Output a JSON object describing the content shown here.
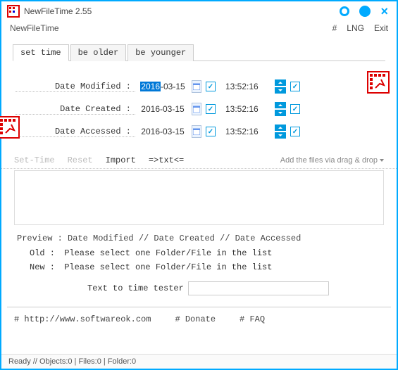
{
  "window": {
    "title": "NewFileTime 2.55",
    "app_name": "NewFileTime"
  },
  "menu": {
    "hash": "#",
    "lng": "LNG",
    "exit": "Exit"
  },
  "tabs": {
    "set_time": "set time",
    "be_older": "be older",
    "be_younger": "be younger"
  },
  "rows": {
    "modified": {
      "label": "Date Modified :",
      "date_prefix": "2016",
      "date_suffix": "-03-15",
      "time": "13:52:16"
    },
    "created": {
      "label": "Date Created :",
      "date": "2016-03-15",
      "time": "13:52:16"
    },
    "accessed": {
      "label": "Date Accessed :",
      "date": "2016-03-15",
      "time": "13:52:16"
    }
  },
  "toolbar": {
    "set_time": "Set-Time",
    "reset": "Reset",
    "import": "Import",
    "txt": "=>txt<=",
    "add_files": "Add the files via drag & drop"
  },
  "preview": {
    "header": "Preview  :    Date Modified     //    Date Created     //    Date Accessed",
    "old_label": "Old :",
    "old_msg": "Please select one Folder/File in the list",
    "new_label": "New :",
    "new_msg": "Please select one Folder/File in the list"
  },
  "tester": {
    "label": "Text to time tester"
  },
  "links": {
    "site": "# http://www.softwareok.com",
    "donate": "# Donate",
    "faq": "# FAQ"
  },
  "status": "Ready // Objects:0  | Files:0   | Folder:0"
}
